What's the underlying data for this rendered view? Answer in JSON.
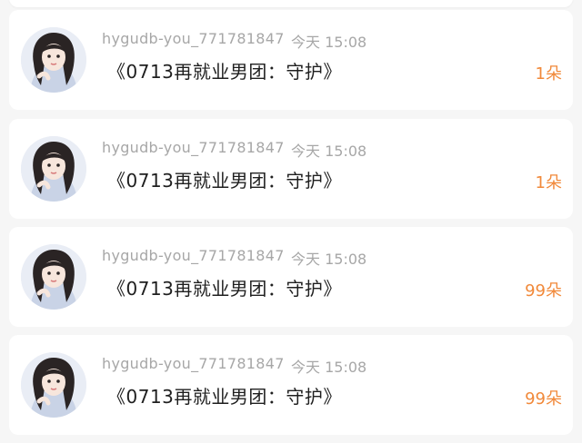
{
  "colors": {
    "background": "#f6f6f6",
    "card": "#ffffff",
    "meta_text": "#a7a7a7",
    "message_text": "#1f1f1f",
    "count_accent": "#f1893a"
  },
  "messages": [
    {
      "avatar_icon": "user-avatar-icon",
      "username": "hygudb-you_771781847",
      "time": "今天 15:08",
      "text": "《0713再就业男团：守护》",
      "count": "1朵"
    },
    {
      "avatar_icon": "user-avatar-icon",
      "username": "hygudb-you_771781847",
      "time": "今天 15:08",
      "text": "《0713再就业男团：守护》",
      "count": "1朵"
    },
    {
      "avatar_icon": "user-avatar-icon",
      "username": "hygudb-you_771781847",
      "time": "今天 15:08",
      "text": "《0713再就业男团：守护》",
      "count": "99朵"
    },
    {
      "avatar_icon": "user-avatar-icon",
      "username": "hygudb-you_771781847",
      "time": "今天 15:08",
      "text": "《0713再就业男团：守护》",
      "count": "99朵"
    }
  ]
}
